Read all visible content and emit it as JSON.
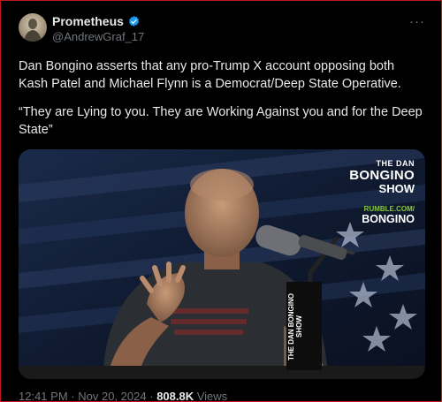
{
  "author": {
    "display_name": "Prometheus",
    "handle": "@AndrewGraf_17",
    "verified": true,
    "avatar_icon": "avatar-portrait",
    "more_icon": "more-horizontal-icon"
  },
  "tweet": {
    "paragraphs": [
      "Dan Bongino asserts that any pro-Trump X account opposing both Kash Patel and Michael Flynn is a Democrat/Deep State Operative.",
      "“They are Lying to you. They are Working Against you and for the Deep State”"
    ]
  },
  "media": {
    "logo_line1": "THE DAN",
    "logo_line2": "BONGINO",
    "logo_line3": "SHOW",
    "rumble_url": "RUMBLE.COM/",
    "rumble_channel": "BONGINO",
    "mic_flag_text": "THE DAN BONGINO SHOW"
  },
  "footer": {
    "time": "12:41 PM",
    "separator": "·",
    "date": "Nov 20, 2024",
    "views_count": "808.8K",
    "views_label": "Views"
  },
  "colors": {
    "background": "#000000",
    "text_primary": "#e7e9ea",
    "text_secondary": "#71767b",
    "verified_blue": "#1d9bf0",
    "frame_border": "#c0181e",
    "rumble_green": "#85c742"
  }
}
